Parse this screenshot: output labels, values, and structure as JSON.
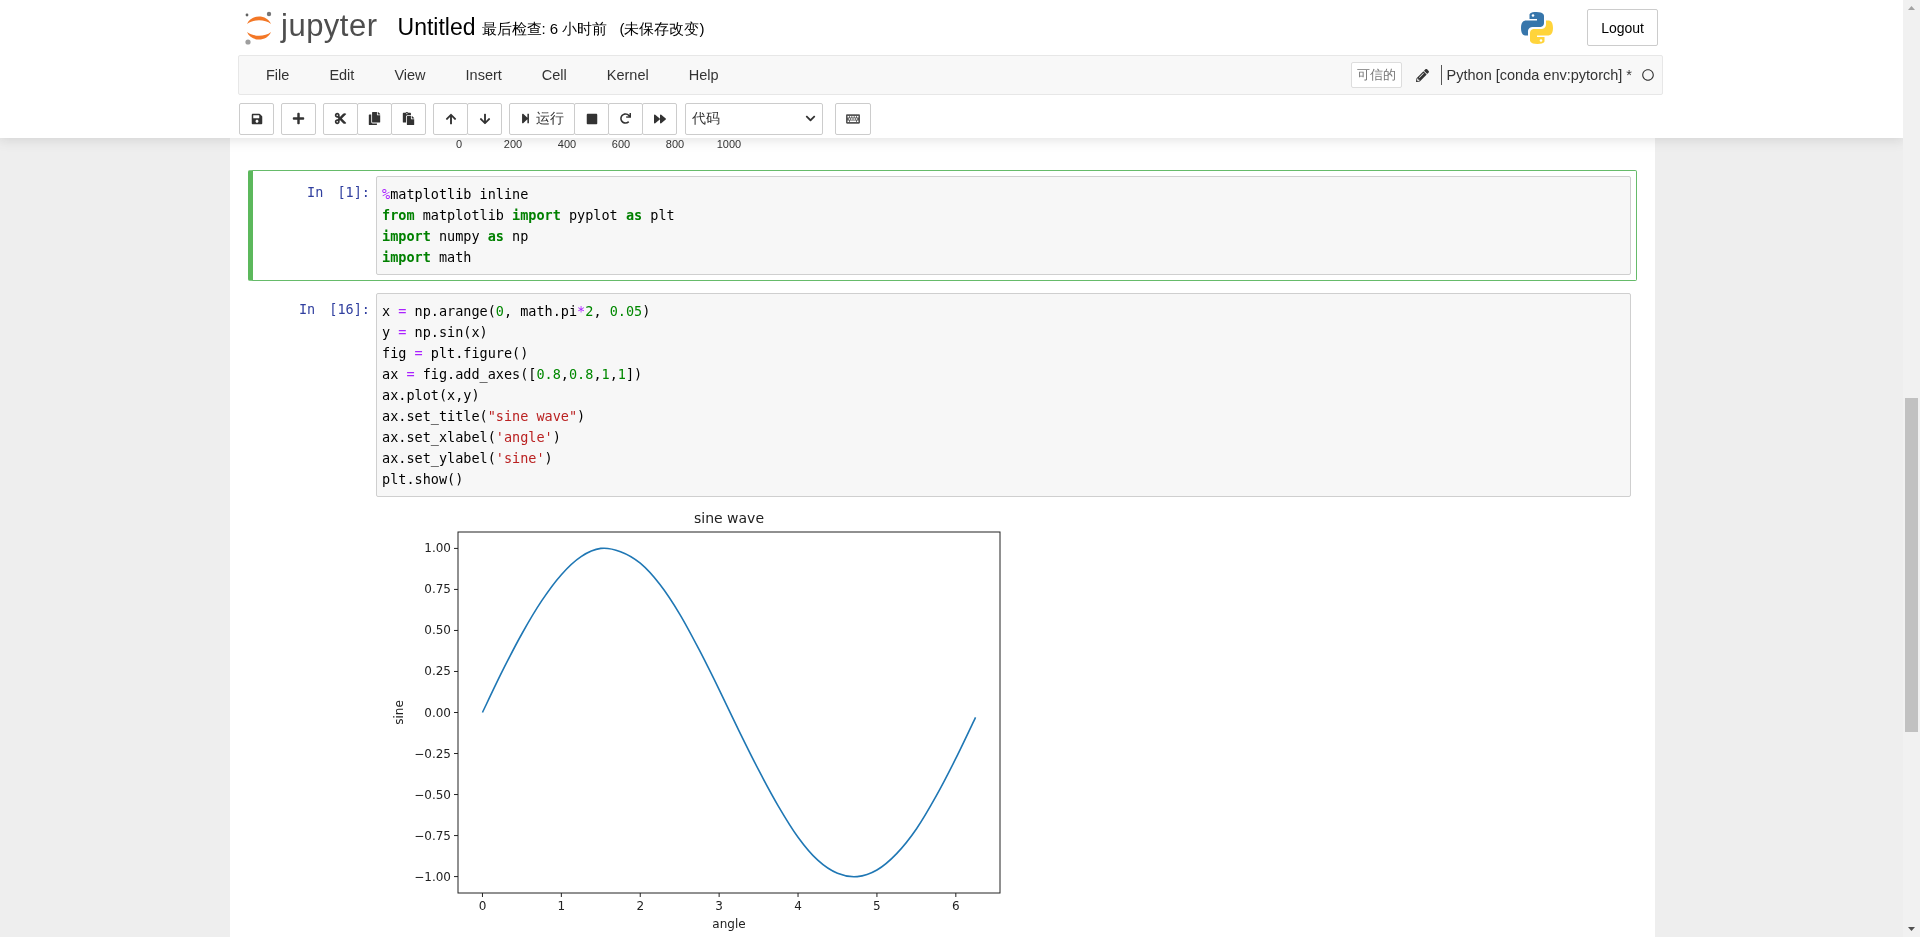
{
  "header": {
    "logo_text": "jupyter",
    "notebook_name": "Untitled",
    "checkpoint": "最后检查: 6 小时前",
    "autosave_status": "(未保存改变)",
    "logout_button": "Logout"
  },
  "menu": [
    "File",
    "Edit",
    "View",
    "Insert",
    "Cell",
    "Kernel",
    "Help"
  ],
  "trusted_badge": "可信的",
  "kernel_name": "Python [conda env:pytorch] *",
  "toolbar": {
    "run_label": "运行",
    "cell_type": "代码"
  },
  "previous_output_ticks": [
    "0",
    "200",
    "400",
    "600",
    "800",
    "1000"
  ],
  "cells": [
    {
      "prompt": "In [1]:",
      "selected": true,
      "lines": [
        [
          {
            "text": "%",
            "kind": "op"
          },
          {
            "text": "matplotlib inline",
            "kind": "plain"
          }
        ],
        [
          {
            "text": "from",
            "kind": "kw"
          },
          {
            "text": " matplotlib ",
            "kind": "plain"
          },
          {
            "text": "import",
            "kind": "kw"
          },
          {
            "text": " pyplot ",
            "kind": "plain"
          },
          {
            "text": "as",
            "kind": "kw"
          },
          {
            "text": " plt",
            "kind": "plain"
          }
        ],
        [
          {
            "text": "import",
            "kind": "kw"
          },
          {
            "text": " numpy ",
            "kind": "plain"
          },
          {
            "text": "as",
            "kind": "kw"
          },
          {
            "text": " np",
            "kind": "plain"
          }
        ],
        [
          {
            "text": "import",
            "kind": "kw"
          },
          {
            "text": " math",
            "kind": "plain"
          }
        ]
      ]
    },
    {
      "prompt": "In [16]:",
      "selected": false,
      "lines": [
        [
          {
            "text": "x ",
            "kind": "plain"
          },
          {
            "text": "=",
            "kind": "op"
          },
          {
            "text": " np.arange(",
            "kind": "plain"
          },
          {
            "text": "0",
            "kind": "num"
          },
          {
            "text": ", math.pi",
            "kind": "plain"
          },
          {
            "text": "*",
            "kind": "op"
          },
          {
            "text": "2",
            "kind": "num"
          },
          {
            "text": ", ",
            "kind": "plain"
          },
          {
            "text": "0.05",
            "kind": "num"
          },
          {
            "text": ")",
            "kind": "plain"
          }
        ],
        [
          {
            "text": "y ",
            "kind": "plain"
          },
          {
            "text": "=",
            "kind": "op"
          },
          {
            "text": " np.sin(x)",
            "kind": "plain"
          }
        ],
        [
          {
            "text": "fig ",
            "kind": "plain"
          },
          {
            "text": "=",
            "kind": "op"
          },
          {
            "text": " plt.figure()",
            "kind": "plain"
          }
        ],
        [
          {
            "text": "ax ",
            "kind": "plain"
          },
          {
            "text": "=",
            "kind": "op"
          },
          {
            "text": " fig.add_axes([",
            "kind": "plain"
          },
          {
            "text": "0.8",
            "kind": "num"
          },
          {
            "text": ",",
            "kind": "plain"
          },
          {
            "text": "0.8",
            "kind": "num"
          },
          {
            "text": ",",
            "kind": "plain"
          },
          {
            "text": "1",
            "kind": "num"
          },
          {
            "text": ",",
            "kind": "plain"
          },
          {
            "text": "1",
            "kind": "num"
          },
          {
            "text": "])",
            "kind": "plain"
          }
        ],
        [
          {
            "text": "ax.plot(x,y)",
            "kind": "plain"
          }
        ],
        [
          {
            "text": "ax.set_title(",
            "kind": "plain"
          },
          {
            "text": "\"sine wave\"",
            "kind": "str"
          },
          {
            "text": ")",
            "kind": "plain"
          }
        ],
        [
          {
            "text": "ax.set_xlabel(",
            "kind": "plain"
          },
          {
            "text": "'angle'",
            "kind": "str"
          },
          {
            "text": ")",
            "kind": "plain"
          }
        ],
        [
          {
            "text": "ax.set_ylabel(",
            "kind": "plain"
          },
          {
            "text": "'sine'",
            "kind": "str"
          },
          {
            "text": ")",
            "kind": "plain"
          }
        ],
        [
          {
            "text": "plt.show()",
            "kind": "plain"
          }
        ]
      ],
      "output": {
        "chart_data": {
          "type": "line",
          "title": "sine wave",
          "xlabel": "angle",
          "ylabel": "sine",
          "x": [
            0,
            0.25,
            0.5,
            0.75,
            1,
            1.25,
            1.5,
            1.75,
            2,
            2.25,
            2.5,
            2.75,
            3,
            3.25,
            3.5,
            3.75,
            4,
            4.25,
            4.5,
            4.75,
            5,
            5.25,
            5.5,
            5.75,
            6,
            6.25
          ],
          "series": [
            {
              "color": "#1f77b4",
              "values": [
                0,
                0.25,
                0.48,
                0.68,
                0.84,
                0.95,
                1.0,
                0.98,
                0.91,
                0.78,
                0.6,
                0.38,
                0.14,
                -0.11,
                -0.35,
                -0.57,
                -0.76,
                -0.9,
                -0.98,
                -1.0,
                -0.96,
                -0.86,
                -0.71,
                -0.51,
                -0.28,
                -0.03
              ]
            }
          ],
          "xlim": [
            -0.31,
            6.56
          ],
          "ylim": [
            -1.1,
            1.1
          ],
          "xticks": [
            0,
            1,
            2,
            3,
            4,
            5,
            6
          ],
          "yticks": [
            {
              "value": 1,
              "label": "1.00"
            },
            {
              "value": 0.75,
              "label": "0.75"
            },
            {
              "value": 0.5,
              "label": "0.50"
            },
            {
              "value": 0.25,
              "label": "0.25"
            },
            {
              "value": 0,
              "label": "0.00"
            },
            {
              "value": -0.25,
              "label": "−0.25"
            },
            {
              "value": -0.5,
              "label": "−0.50"
            },
            {
              "value": -0.75,
              "label": "−0.75"
            },
            {
              "value": -1,
              "label": "−1.00"
            }
          ]
        }
      }
    }
  ]
}
